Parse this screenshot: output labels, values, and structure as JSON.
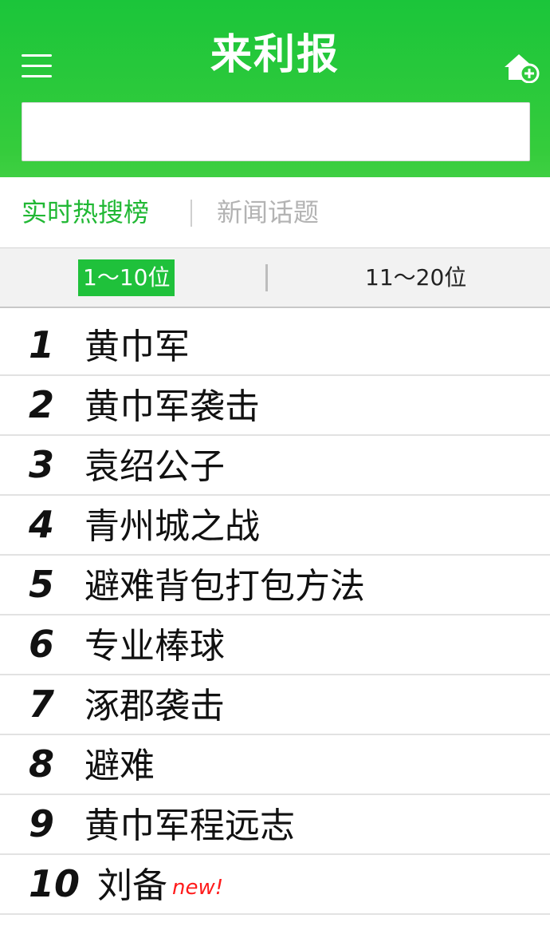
{
  "header": {
    "title": "来利报",
    "menu_icon": "hamburger-menu-icon",
    "add_home_icon": "home-add-icon",
    "background_color": "#2fca3d",
    "search": {
      "value": "",
      "placeholder": ""
    }
  },
  "main_tabs": [
    {
      "label": "实时热搜榜",
      "active": true
    },
    {
      "label": "新闻话题",
      "active": false
    }
  ],
  "range_tabs": [
    {
      "label": "1～10位",
      "active": true
    },
    {
      "label": "11～20位",
      "active": false
    }
  ],
  "ranking": [
    {
      "rank": "1",
      "term": "黄巾军"
    },
    {
      "rank": "2",
      "term": "黄巾军袭击"
    },
    {
      "rank": "3",
      "term": "袁绍公子"
    },
    {
      "rank": "4",
      "term": "青州城之战"
    },
    {
      "rank": "5",
      "term": "避难背包打包方法"
    },
    {
      "rank": "6",
      "term": "专业棒球"
    },
    {
      "rank": "7",
      "term": "涿郡袭击"
    },
    {
      "rank": "8",
      "term": "避难"
    },
    {
      "rank": "9",
      "term": "黄巾军程远志"
    },
    {
      "rank": "10",
      "term": "刘备",
      "badge": "new!"
    }
  ],
  "colors": {
    "accent": "#21b834",
    "active_range_bg": "#1fc13b",
    "new_badge": "#ff1b1b",
    "inactive_tab": "#b3b3b3"
  }
}
